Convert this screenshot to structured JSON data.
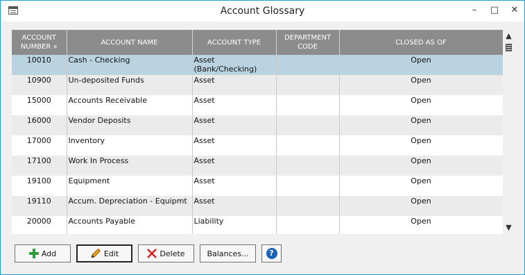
{
  "window": {
    "title": "Account Glossary",
    "minimize": "–",
    "maximize": "□",
    "close": "✕"
  },
  "table": {
    "columns": [
      "ACCOUNT NUMBER »",
      "ACCOUNT NAME",
      "ACCOUNT TYPE",
      "DEPARTMENT CODE",
      "CLOSED AS OF"
    ],
    "rows": [
      {
        "number": "10010",
        "name": "Cash - Checking",
        "type": "Asset",
        "type2": "(Bank/Checking)",
        "dept": "",
        "closed": "Open"
      },
      {
        "number": "10900",
        "name": "Un-deposited Funds",
        "type": "Asset",
        "type2": "",
        "dept": "",
        "closed": "Open"
      },
      {
        "number": "15000",
        "name": "Accounts Receivable",
        "type": "Asset",
        "type2": "",
        "dept": "",
        "closed": "Open"
      },
      {
        "number": "16000",
        "name": "Vendor Deposits",
        "type": "Asset",
        "type2": "",
        "dept": "",
        "closed": "Open"
      },
      {
        "number": "17000",
        "name": "Inventory",
        "type": "Asset",
        "type2": "",
        "dept": "",
        "closed": "Open"
      },
      {
        "number": "17100",
        "name": "Work In Process",
        "type": "Asset",
        "type2": "",
        "dept": "",
        "closed": "Open"
      },
      {
        "number": "19100",
        "name": "Equipment",
        "type": "Asset",
        "type2": "",
        "dept": "",
        "closed": "Open"
      },
      {
        "number": "19110",
        "name": "Accum. Depreciation - Equipmt",
        "type": "Asset",
        "type2": "",
        "dept": "",
        "closed": "Open"
      },
      {
        "number": "20000",
        "name": "Accounts Payable",
        "type": "Liability",
        "type2": "",
        "dept": "",
        "closed": "Open"
      }
    ]
  },
  "buttons": {
    "add": "Add",
    "edit": "Edit",
    "delete": "Delete",
    "balances": "Balances...",
    "help": "?"
  },
  "colors": {
    "header_bg": "#8c8c8c",
    "selected_row": "#b9d3e0",
    "stripe": "#ebebeb",
    "add_icon": "#2e9e3a",
    "delete_icon": "#d22222",
    "help_icon": "#1a63b8"
  },
  "icons": {
    "add": "plus-icon",
    "edit": "pencil-icon",
    "delete": "x-icon",
    "help": "question-icon"
  }
}
